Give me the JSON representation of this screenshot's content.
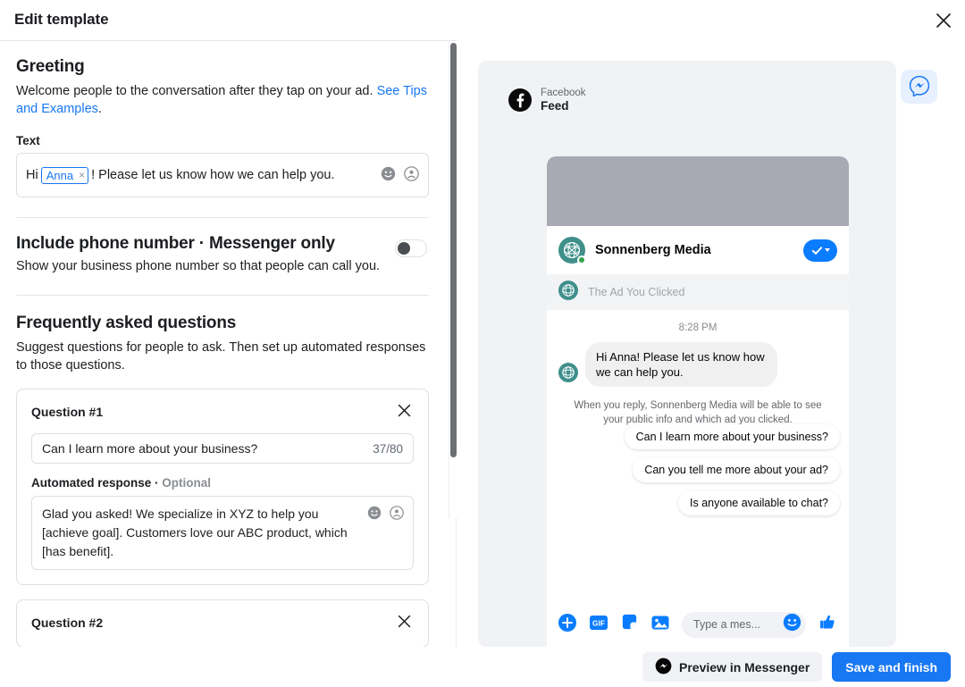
{
  "header": {
    "title": "Edit template",
    "close_label": "Close"
  },
  "greeting": {
    "title": "Greeting",
    "description_before_link": "Welcome people to the conversation after they tap on your ad. ",
    "link_text": "See Tips and Examples",
    "description_after_link": ".",
    "text_label": "Text",
    "value_prefix": "Hi",
    "token_label": "Anna",
    "token_remove": "×",
    "value_suffix": "! Please let us know how we can help you."
  },
  "phone_section": {
    "title": "Include phone number · Messenger only",
    "description": "Show your business phone number so that people can call you.",
    "toggle_state": "off"
  },
  "faq": {
    "title": "Frequently asked questions",
    "description": "Suggest questions for people to ask. Then set up automated responses to those questions.",
    "questions": [
      {
        "card_title": "Question #1",
        "question_text": "Can I learn more about your business?",
        "counter": "37/80",
        "response_label": "Automated response",
        "response_optional": "Optional",
        "response_text": "Glad you asked! We specialize in XYZ to help you [achieve goal]. Customers love our ABC product, which [has benefit]."
      },
      {
        "card_title": "Question #2"
      }
    ]
  },
  "preview": {
    "platform_top": "Facebook",
    "platform_bottom": "Feed",
    "messenger_button": "messenger-icon",
    "business_name": "Sonnenberg Media",
    "ad_strip_text": "The Ad You Clicked",
    "timestamp": "8:28 PM",
    "greeting_bubble": "Hi Anna! Please let us know how we can help you.",
    "disclaimer": "When you reply, Sonnenberg Media will be able to see your public info and which ad you clicked.",
    "suggestions": [
      "Can I learn more about your business?",
      "Can you tell me more about your ad?",
      "Is anyone available to chat?"
    ],
    "composer_placeholder": "Type a mes...",
    "composer_icons": [
      "plus-icon",
      "gif-icon",
      "sticker-icon",
      "photo-icon",
      "emoji-icon",
      "thumbs-up-icon"
    ]
  },
  "footer": {
    "preview_button": "Preview in Messenger",
    "save_button": "Save and finish"
  },
  "colors": {
    "accent_blue": "#1877f2",
    "messenger_blue": "#0a7cff",
    "avatar_teal": "#3f8f8b",
    "online_green": "#31a24c",
    "panel_gray": "#f0f2f5"
  }
}
